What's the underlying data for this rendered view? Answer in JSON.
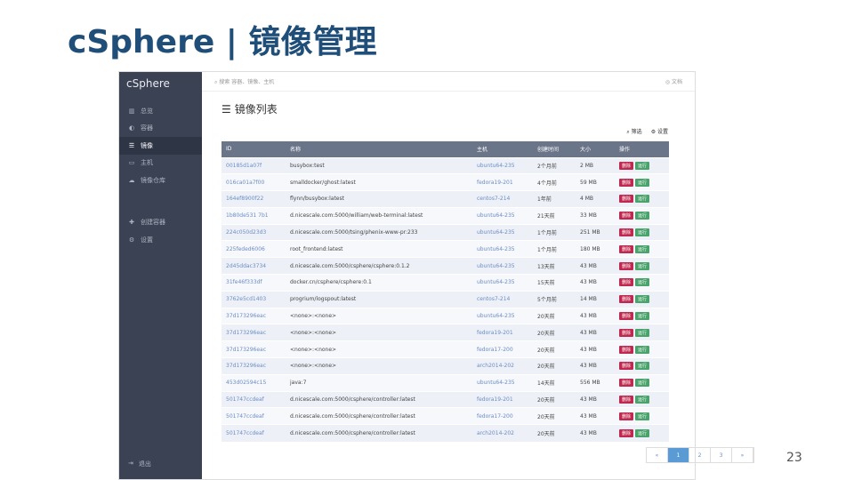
{
  "slide": {
    "title": "cSphere | 镜像管理",
    "page": "23"
  },
  "app": {
    "brand": "cSphere",
    "search_placeholder": "搜索 容器、镜像、主机",
    "docs": "文档",
    "heading": "镜像列表",
    "filter": "筛选",
    "settings": "设置",
    "logout": "退出"
  },
  "nav": [
    {
      "icon": "▥",
      "label": "总览"
    },
    {
      "icon": "◐",
      "label": "容器"
    },
    {
      "icon": "☰",
      "label": "镜像"
    },
    {
      "icon": "▭",
      "label": "主机"
    },
    {
      "icon": "☁",
      "label": "镜像仓库"
    }
  ],
  "nav2": [
    {
      "icon": "✚",
      "label": "创建容器"
    },
    {
      "icon": "⚙",
      "label": "设置"
    }
  ],
  "columns": [
    "ID",
    "名称",
    "主机",
    "创建时间",
    "大小",
    "操作"
  ],
  "actions": {
    "delete": "删除",
    "run": "运行"
  },
  "rows": [
    [
      "00185d1a07f",
      "busybox:test",
      "ubuntu64-235",
      "2个月前",
      "2 MB"
    ],
    [
      "016ca01a7f00",
      "smalldocker/ghost:latest",
      "fedora19-201",
      "4个月前",
      "59 MB"
    ],
    [
      "164ef8900f22",
      "flynn/busybox:latest",
      "centos7-214",
      "1年前",
      "4 MB"
    ],
    [
      "1b80de531 7b1",
      "d.nicescale.com:5000/william/web-terminal:latest",
      "ubuntu64-235",
      "21天前",
      "33 MB"
    ],
    [
      "224c050d23d3",
      "d.nicescale.com:5000/tsing/phenix-www-pr:233",
      "ubuntu64-235",
      "1个月前",
      "251 MB"
    ],
    [
      "225feded6006",
      "root_frontend:latest",
      "ubuntu64-235",
      "1个月前",
      "180 MB"
    ],
    [
      "2d45ddac3734",
      "d.nicescale.com:5000/csphere/csphere:0.1.2",
      "ubuntu64-235",
      "13天前",
      "43 MB"
    ],
    [
      "31fe46f333df",
      "docker.cn/csphere/csphere:0.1",
      "ubuntu64-235",
      "15天前",
      "43 MB"
    ],
    [
      "3762e5cd1403",
      "progrium/logspout:latest",
      "centos7-214",
      "5个月前",
      "14 MB"
    ],
    [
      "37d173296eac",
      "<none>:<none>",
      "ubuntu64-235",
      "20天前",
      "43 MB"
    ],
    [
      "37d173296eac",
      "<none>:<none>",
      "fedora19-201",
      "20天前",
      "43 MB"
    ],
    [
      "37d173296eac",
      "<none>:<none>",
      "fedora17-200",
      "20天前",
      "43 MB"
    ],
    [
      "37d173296eac",
      "<none>:<none>",
      "arch2014-202",
      "20天前",
      "43 MB"
    ],
    [
      "453d02594c15",
      "java:7",
      "ubuntu64-235",
      "14天前",
      "556 MB"
    ],
    [
      "501747ccdeaf",
      "d.nicescale.com:5000/csphere/controller:latest",
      "fedora19-201",
      "20天前",
      "43 MB"
    ],
    [
      "501747ccdeaf",
      "d.nicescale.com:5000/csphere/controller:latest",
      "fedora17-200",
      "20天前",
      "43 MB"
    ],
    [
      "501747ccdeaf",
      "d.nicescale.com:5000/csphere/controller:latest",
      "arch2014-202",
      "20天前",
      "43 MB"
    ]
  ],
  "pager": [
    "«",
    "1",
    "2",
    "3",
    "»"
  ],
  "pager_current": "1"
}
